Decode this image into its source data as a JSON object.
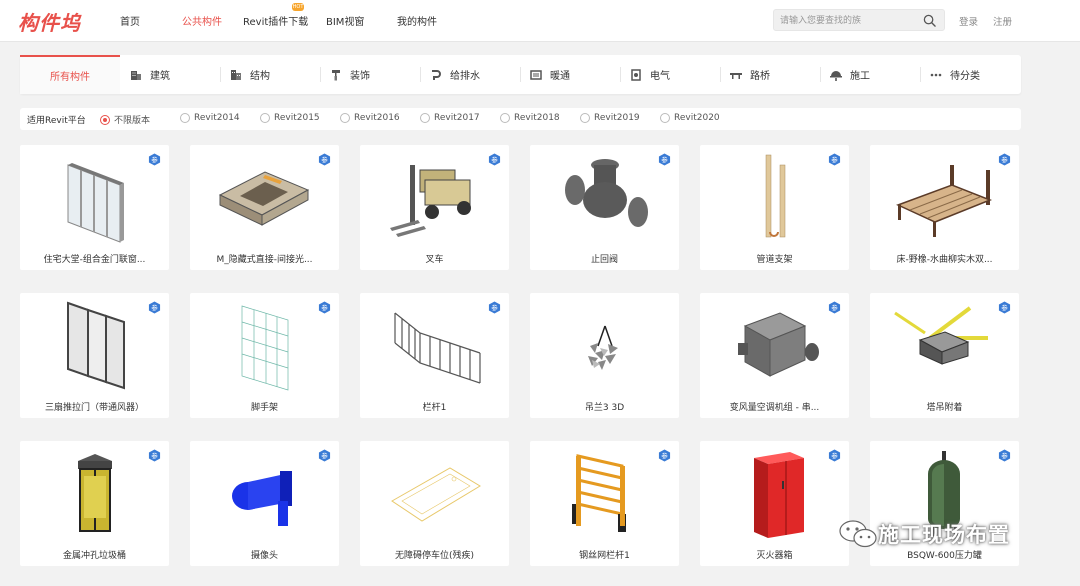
{
  "brand": {
    "logo_text": "构件坞",
    "accent": "#e8514b"
  },
  "nav": {
    "items": [
      "首页",
      "公共构件",
      "Revit插件下载",
      "BIM视窗",
      "我的构件"
    ],
    "active": "公共构件",
    "hot_badge": "HOT"
  },
  "search": {
    "placeholder": "请输入您要查找的族",
    "value": ""
  },
  "auth": {
    "login": "登录",
    "register": "注册"
  },
  "categories": [
    {
      "label": "所有构件",
      "icon": "all-icon",
      "active": true
    },
    {
      "label": "建筑",
      "icon": "building-icon"
    },
    {
      "label": "结构",
      "icon": "structure-icon"
    },
    {
      "label": "装饰",
      "icon": "brush-icon"
    },
    {
      "label": "给排水",
      "icon": "pipe-icon"
    },
    {
      "label": "暖通",
      "icon": "hvac-icon"
    },
    {
      "label": "电气",
      "icon": "electric-icon"
    },
    {
      "label": "路桥",
      "icon": "bridge-icon"
    },
    {
      "label": "施工",
      "icon": "construction-icon"
    },
    {
      "label": "待分类",
      "icon": "more-icon"
    }
  ],
  "platform": {
    "label": "适用Revit平台",
    "options": [
      "不限版本",
      "Revit2014",
      "Revit2015",
      "Revit2016",
      "Revit2017",
      "Revit2018",
      "Revit2019",
      "Revit2020"
    ],
    "selected": "不限版本"
  },
  "items": [
    {
      "title": "住宅大堂-组合金门联窗...",
      "icon": "curtain-door-model-icon"
    },
    {
      "title": "M_隐藏式直接-间接光...",
      "icon": "recessed-light-model-icon"
    },
    {
      "title": "叉车",
      "icon": "forklift-model-icon"
    },
    {
      "title": "止回阀",
      "icon": "check-valve-model-icon"
    },
    {
      "title": "管道支架",
      "icon": "pipe-support-model-icon"
    },
    {
      "title": "床-野橡-水曲柳实木双...",
      "icon": "bed-model-icon"
    },
    {
      "title": "三扇推拉门（带通风器）",
      "icon": "sliding-door-model-icon"
    },
    {
      "title": "脚手架",
      "icon": "scaffold-model-icon"
    },
    {
      "title": "栏杆1",
      "icon": "railing-model-icon"
    },
    {
      "title": "吊兰3 3D",
      "icon": "hanging-plant-model-icon"
    },
    {
      "title": "变风量空调机组 - 串...",
      "icon": "vav-unit-model-icon"
    },
    {
      "title": "塔吊附着",
      "icon": "tower-crane-tie-model-icon"
    },
    {
      "title": "金属冲孔垃圾桶",
      "icon": "trash-bin-model-icon"
    },
    {
      "title": "摄像头",
      "icon": "camera-model-icon"
    },
    {
      "title": "无障碍停车位(残疾)",
      "icon": "parking-space-model-icon"
    },
    {
      "title": "钢丝网栏杆1",
      "icon": "wire-fence-model-icon"
    },
    {
      "title": "灭火器箱",
      "icon": "extinguisher-box-model-icon"
    },
    {
      "title": "BSQW-600压力罐",
      "icon": "pressure-tank-model-icon"
    }
  ],
  "card_badge": "参",
  "watermark": {
    "text": "施工现场布置"
  }
}
